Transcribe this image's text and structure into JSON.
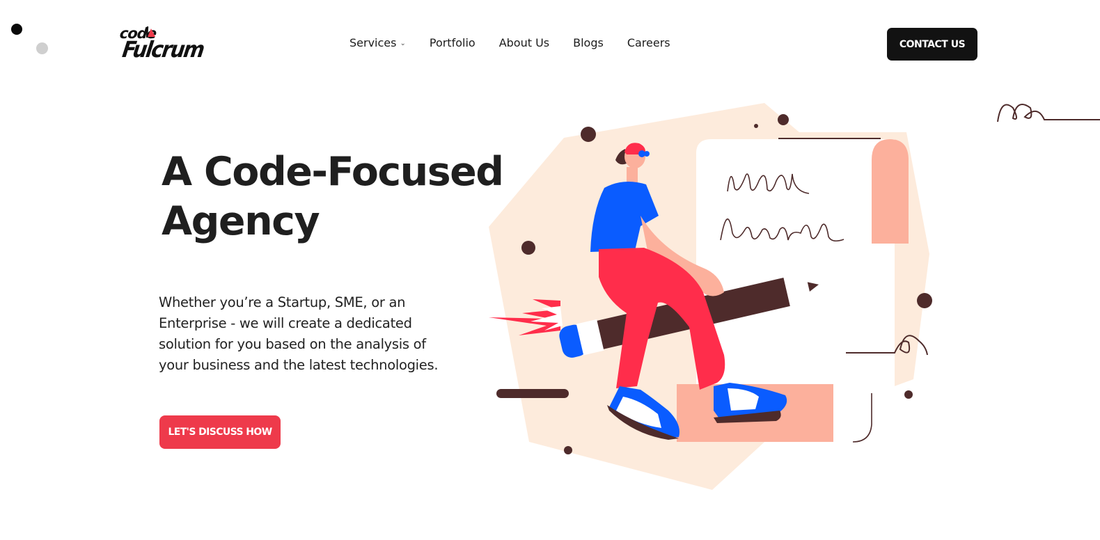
{
  "brand": {
    "logo_top": "code",
    "logo_bottom": "Fulcrum"
  },
  "nav": {
    "items": [
      {
        "label": "Services",
        "has_dropdown": true
      },
      {
        "label": "Portfolio",
        "has_dropdown": false
      },
      {
        "label": "About Us",
        "has_dropdown": false
      },
      {
        "label": "Blogs",
        "has_dropdown": false
      },
      {
        "label": "Careers",
        "has_dropdown": false
      }
    ]
  },
  "header": {
    "contact_label": "CONTACT US"
  },
  "hero": {
    "title_line1": "A Code-Focused",
    "title_line2": "Agency",
    "description": "Whether you’re a Startup, SME, or an Enterprise - we will create a dedicated solution for you based on the analysis of your business and the latest technologies.",
    "cta_label": "LET'S DISCUSS HOW"
  },
  "icons": {
    "chevron": "chevron-down-icon",
    "logo_mark": "red-triangle-icon"
  },
  "colors": {
    "accent_red": "#ee3a4b",
    "dark_button": "#121212",
    "illustration_bg": "#fdebdc",
    "shirt_blue": "#0a5cff",
    "pants_red": "#ff2d4b",
    "pencil_brown": "#4e2b2b",
    "salmon": "#fcb09c"
  }
}
